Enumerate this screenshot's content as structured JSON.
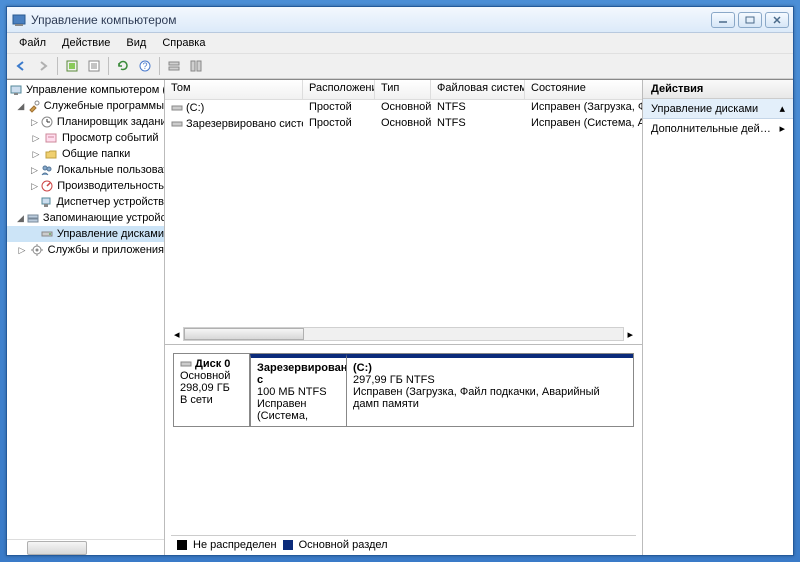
{
  "window": {
    "title": "Управление компьютером"
  },
  "menu": {
    "file": "Файл",
    "action": "Действие",
    "view": "Вид",
    "help": "Справка"
  },
  "tree": {
    "root": "Управление компьютером (л",
    "n1": "Служебные программы",
    "n1a": "Планировщик задани",
    "n1b": "Просмотр событий",
    "n1c": "Общие папки",
    "n1d": "Локальные пользоват",
    "n1e": "Производительность",
    "n1f": "Диспетчер устройств",
    "n2": "Запоминающие устройст",
    "n2a": "Управление дисками",
    "n3": "Службы и приложения"
  },
  "vol": {
    "cols": {
      "c1": "Том",
      "c2": "Расположение",
      "c3": "Тип",
      "c4": "Файловая система",
      "c5": "Состояние"
    },
    "r1": {
      "c1": "(C:)",
      "c2": "Простой",
      "c3": "Основной",
      "c4": "NTFS",
      "c5": "Исправен (Загрузка, Фай"
    },
    "r2": {
      "c1": "Зарезервировано системой",
      "c2": "Простой",
      "c3": "Основной",
      "c4": "NTFS",
      "c5": "Исправен (Система, Акти"
    }
  },
  "disk": {
    "title": "Диск 0",
    "type": "Основной",
    "size": "298,09 ГБ",
    "status": "В сети",
    "p1": {
      "title": "Зарезервировано с",
      "size": "100 МБ NTFS",
      "status": "Исправен (Система,"
    },
    "p2": {
      "title": "(C:)",
      "size": "297,99 ГБ NTFS",
      "status": "Исправен (Загрузка, Файл подкачки, Аварийный дамп памяти"
    }
  },
  "legend": {
    "l1": "Не распределен",
    "l2": "Основной раздел"
  },
  "actions": {
    "header": "Действия",
    "sub": "Управление дисками",
    "item1": "Дополнительные дей…"
  },
  "colors": {
    "partition_header": "#0a2a7a",
    "unalloc": "#000000",
    "primary": "#0a2a7a"
  }
}
